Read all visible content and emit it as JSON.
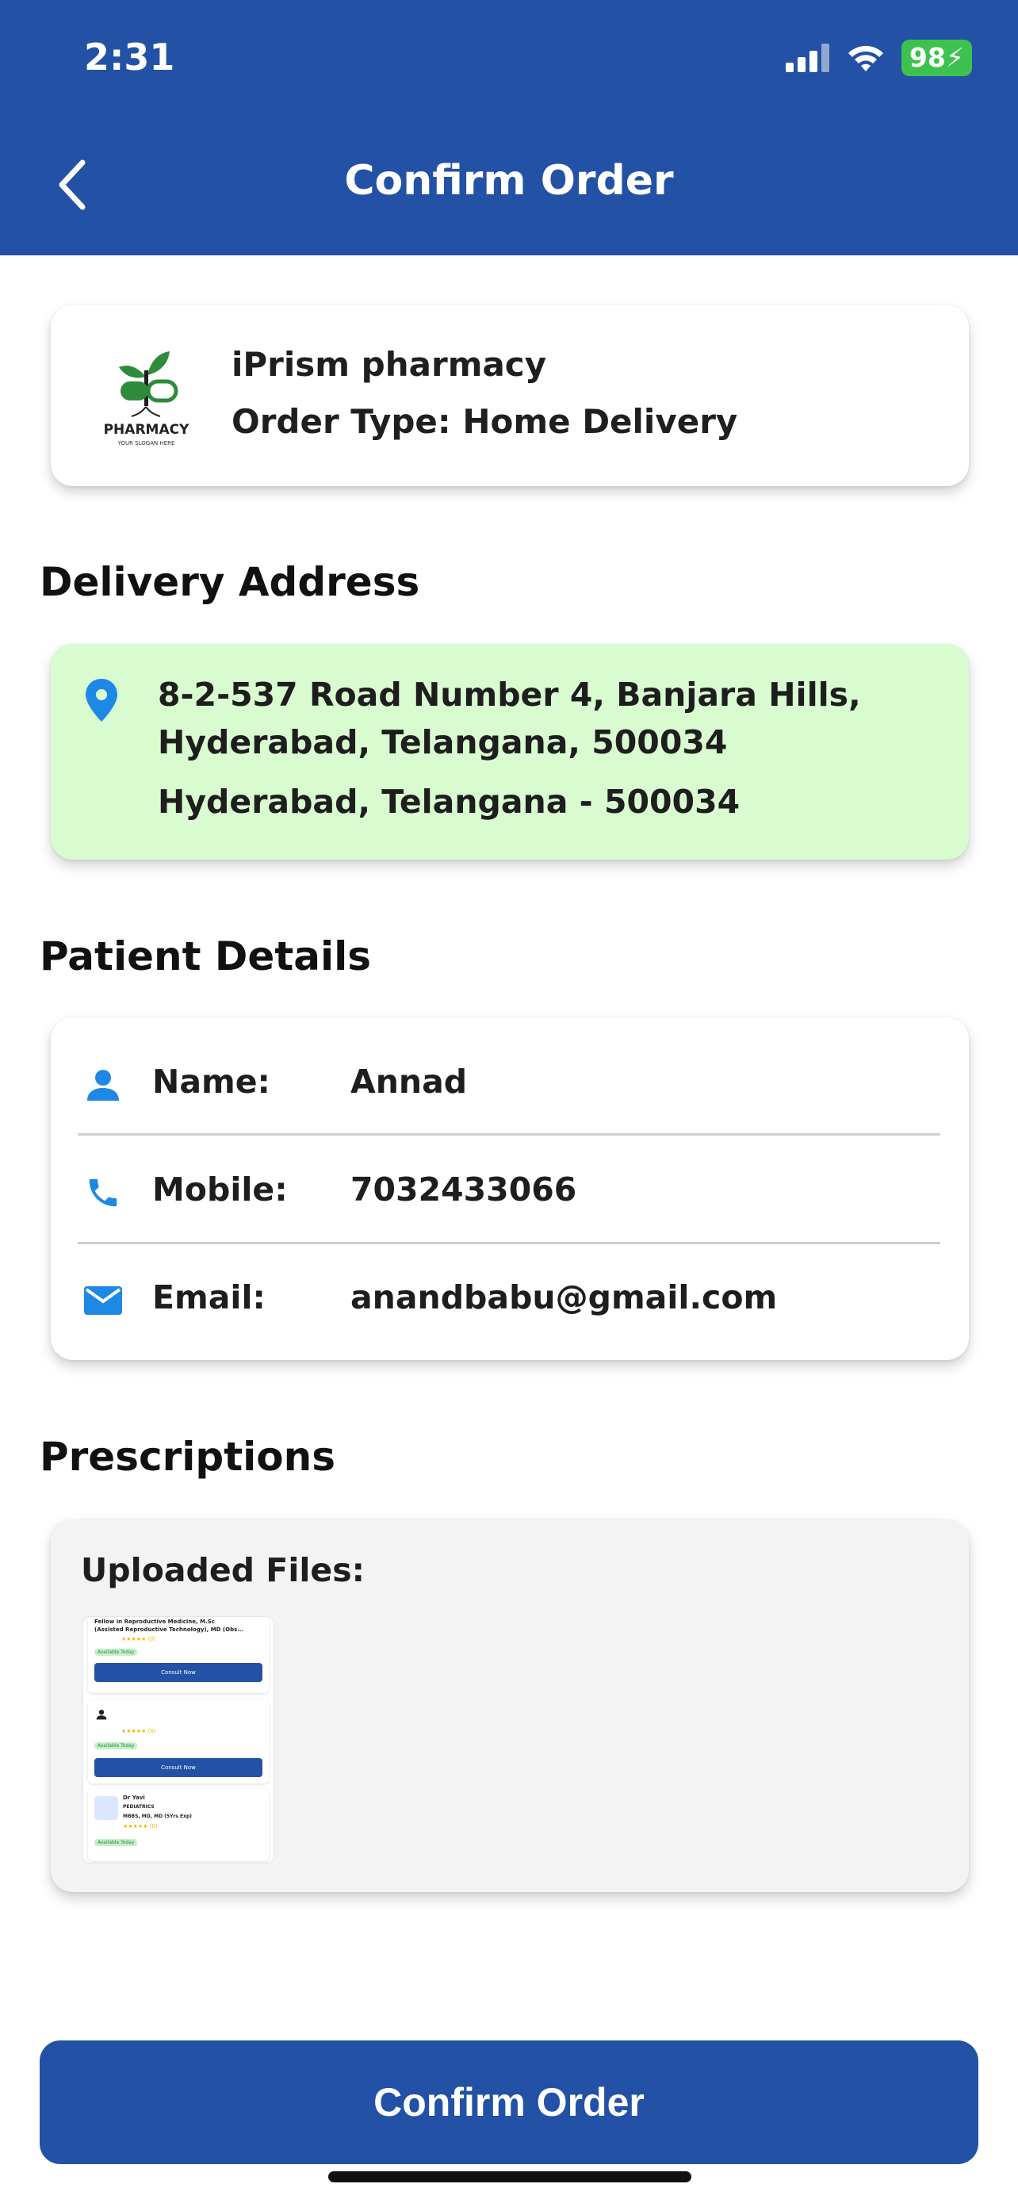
{
  "status_bar": {
    "time": "2:31",
    "battery": "98"
  },
  "header": {
    "title": "Confirm Order"
  },
  "pharmacy": {
    "logo_text": "PHARMACY",
    "logo_subtext": "YOUR SLOGAN HERE",
    "name": "iPrism pharmacy",
    "order_type": "Order Type: Home Delivery"
  },
  "delivery": {
    "section_title": "Delivery Address",
    "line1": "8-2-537 Road Number 4, Banjara Hills,",
    "line2": "Hyderabad, Telangana, 500034",
    "line3": "Hyderabad, Telangana - 500034"
  },
  "patient": {
    "section_title": "Patient Details",
    "rows": [
      {
        "label": "Name:",
        "value": "Annad"
      },
      {
        "label": "Mobile:",
        "value": "7032433066"
      },
      {
        "label": "Email:",
        "value": "anandbabu@gmail.com"
      }
    ]
  },
  "prescriptions": {
    "section_title": "Prescriptions",
    "uploaded_label": "Uploaded Files:",
    "thumbnail": {
      "line1": "Fellow in Reproductive Medicine, M.Sc",
      "line2": "(Assisted Reproductive Technology), MD (Obs...",
      "rating1": "★★★★★ (0)",
      "available": "Available Today",
      "consult": "Consult Now",
      "rating2": "★★★★★ (0)",
      "doctor": "Dr Yavi",
      "specialty": "PEDIATRICS",
      "qualification": "MBBS, MD, MD (5Yrs Exp)",
      "rating3": "★★★★★ (0)"
    }
  },
  "footer": {
    "confirm_label": "Confirm Order"
  },
  "colors": {
    "primary": "#2351a6",
    "address_bg": "#d9fbd0",
    "icon_blue": "#1e88e5"
  }
}
